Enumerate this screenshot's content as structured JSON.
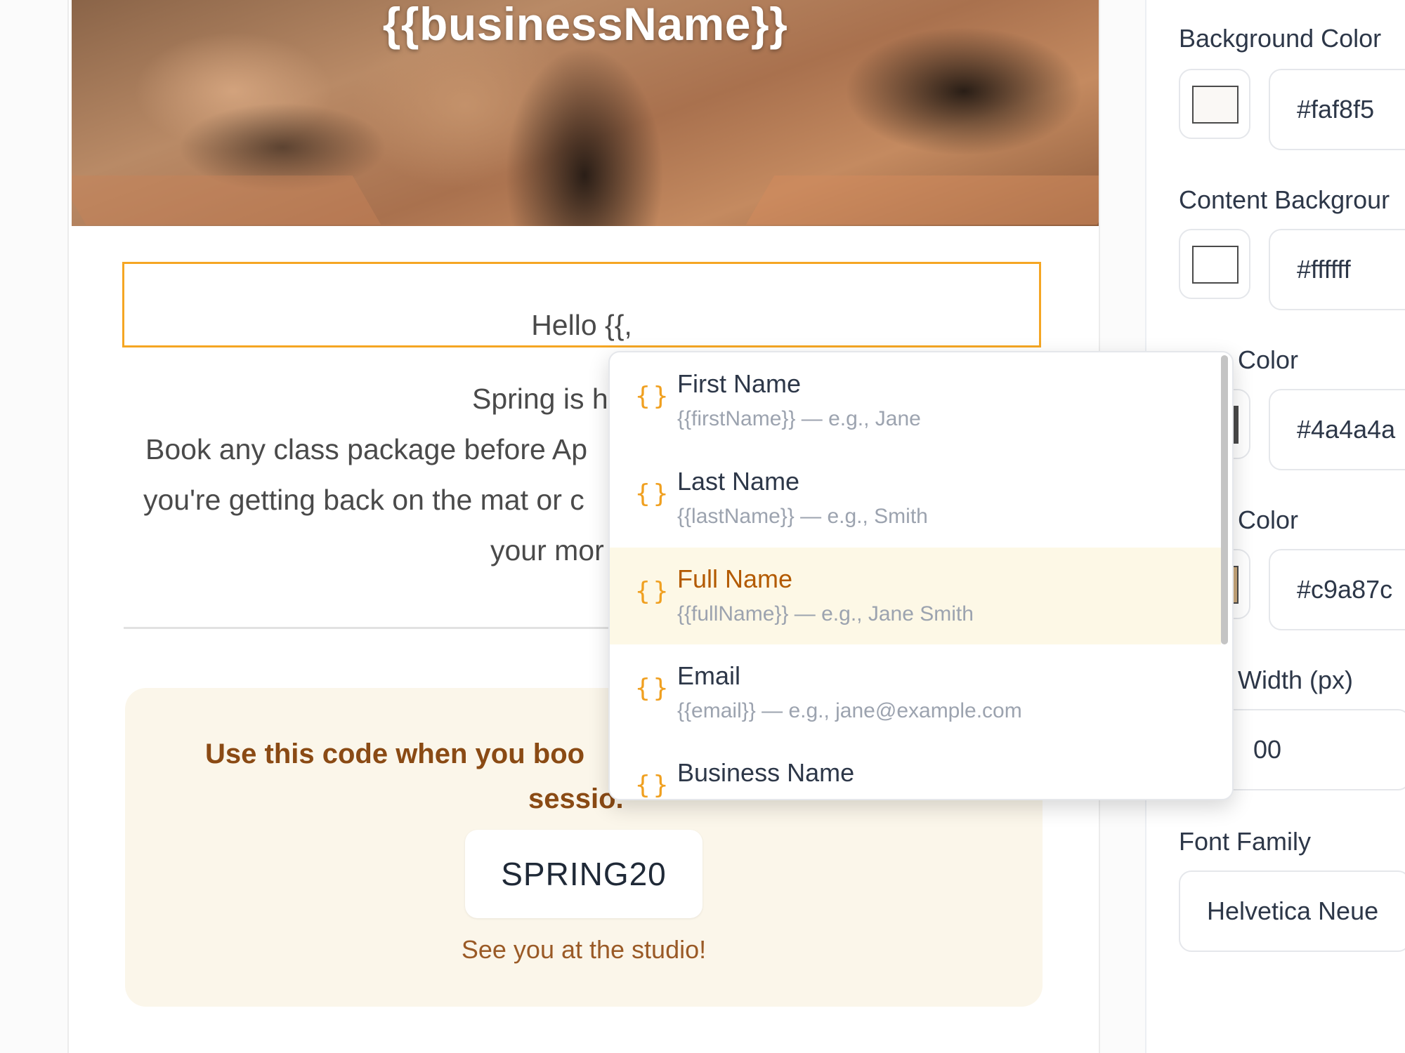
{
  "email": {
    "hero_title": "{{businessName}}",
    "greeting": "Hello {{,",
    "body_lines": [
      "Spring is here—time to r",
      "Book any class package before Ap",
      "you're getting back on the mat or c",
      "your mor"
    ],
    "promo_head_line1": "Use this code when you boo",
    "promo_head_line2": "sessio.",
    "promo_code": "SPRING20",
    "promo_footer": "See you at the studio!"
  },
  "panel": {
    "background_color_label": "Background Color",
    "background_color_value": "#faf8f5",
    "content_background_label": "Content Backgrour",
    "content_background_value": "#ffffff",
    "text_color_label": "Color",
    "text_color_value": "#4a4a4a",
    "accent_color_label": "Color",
    "accent_color_value": "#c9a87c",
    "width_label": "Width (px)",
    "width_value": "00",
    "font_family_label": "Font Family",
    "font_family_value": "Helvetica Neue"
  },
  "dropdown": {
    "items": [
      {
        "icon": "{}",
        "label": "First Name",
        "sub": "{{firstName}} — e.g., Jane"
      },
      {
        "icon": "{}",
        "label": "Last Name",
        "sub": "{{lastName}} — e.g., Smith"
      },
      {
        "icon": "{}",
        "label": "Full Name",
        "sub": "{{fullName}} — e.g., Jane Smith"
      },
      {
        "icon": "{}",
        "label": "Email",
        "sub": "{{email}} — e.g., jane@example.com"
      },
      {
        "icon": "{}",
        "label": "Business Name",
        "sub": ""
      }
    ]
  },
  "colors": {
    "accent": "#f5a623",
    "highlight_row": "#fdf8e6",
    "brand_brown": "#8a4a14",
    "swatch_background": "#faf8f5",
    "swatch_content": "#ffffff",
    "swatch_text": "#4a4a4a",
    "swatch_accent": "#c9a87c"
  }
}
